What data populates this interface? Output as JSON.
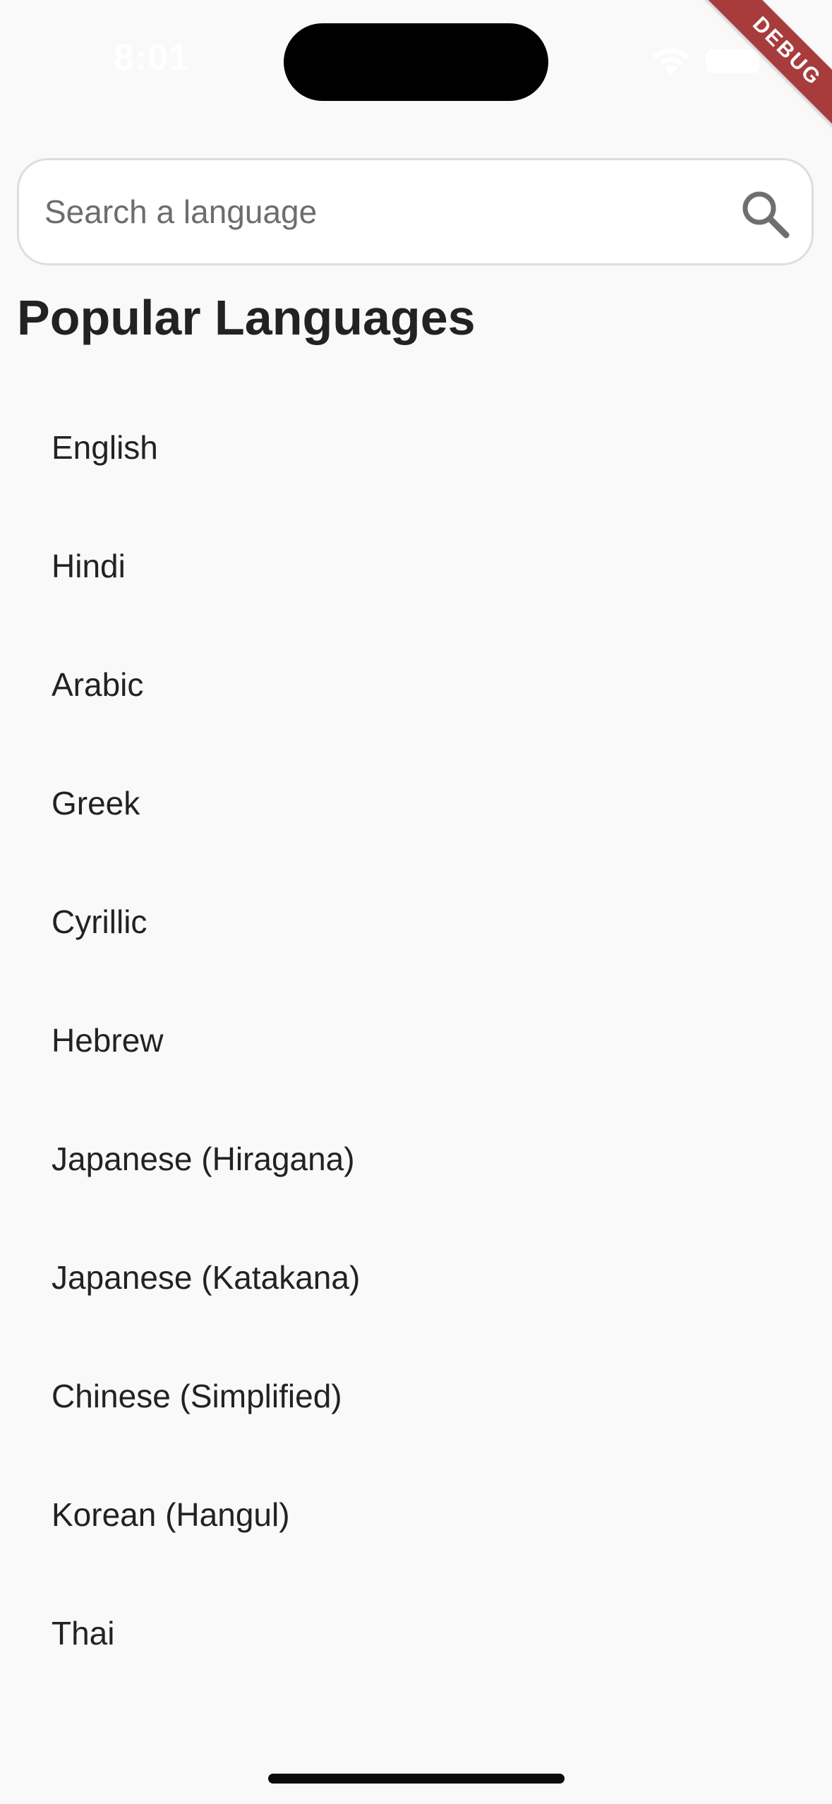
{
  "status_bar": {
    "time": "8:01"
  },
  "debug_banner": {
    "label": "DEBUG",
    "color": "#a83c3c"
  },
  "search": {
    "placeholder": "Search a language",
    "value": "",
    "icon": "search-icon"
  },
  "section": {
    "title": "Popular Languages"
  },
  "languages": [
    "English",
    "Hindi",
    "Arabic",
    "Greek",
    "Cyrillic",
    "Hebrew",
    "Japanese (Hiragana)",
    "Japanese (Katakana)",
    "Chinese (Simplified)",
    "Korean (Hangul)",
    "Thai"
  ]
}
